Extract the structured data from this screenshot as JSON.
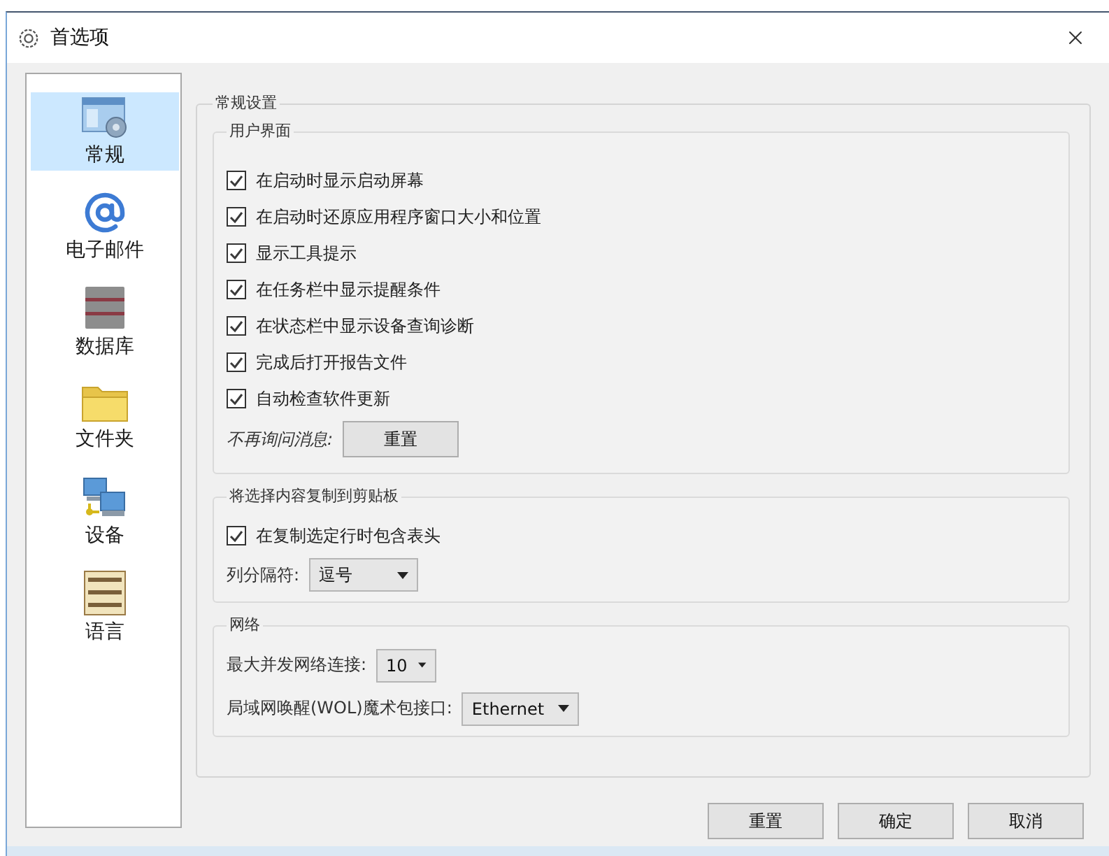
{
  "window": {
    "title": "首选项"
  },
  "sidebar": {
    "items": [
      {
        "label": "常规",
        "kind": "general",
        "selected": true
      },
      {
        "label": "电子邮件",
        "kind": "email",
        "selected": false
      },
      {
        "label": "数据库",
        "kind": "database",
        "selected": false
      },
      {
        "label": "文件夹",
        "kind": "folder",
        "selected": false
      },
      {
        "label": "设备",
        "kind": "device",
        "selected": false
      },
      {
        "label": "语言",
        "kind": "language",
        "selected": false
      }
    ]
  },
  "settings": {
    "title": "常规设置",
    "user_interface": {
      "title": "用户界面",
      "options": [
        {
          "label": "在启动时显示启动屏幕",
          "checked": true
        },
        {
          "label": "在启动时还原应用程序窗口大小和位置",
          "checked": true
        },
        {
          "label": "显示工具提示",
          "checked": true
        },
        {
          "label": "在任务栏中显示提醒条件",
          "checked": true
        },
        {
          "label": "在状态栏中显示设备查询诊断",
          "checked": true
        },
        {
          "label": "完成后打开报告文件",
          "checked": true
        },
        {
          "label": "自动检查软件更新",
          "checked": true
        }
      ],
      "message_label": "不再询问消息:",
      "message_button": "重置"
    },
    "clipboard": {
      "title": "将选择内容复制到剪贴板",
      "options": [
        {
          "label": "在复制选定行时包含表头",
          "checked": true
        }
      ],
      "separator_label": "列分隔符:",
      "separator_value": "逗号"
    },
    "network": {
      "title": "网络",
      "fields": [
        {
          "label": "最大并发网络连接:",
          "value": "10"
        },
        {
          "label": "局域网唤醒(WOL)魔术包接口:",
          "value": "Ethernet"
        }
      ]
    }
  },
  "buttons": [
    "重置",
    "确定",
    "取消"
  ]
}
